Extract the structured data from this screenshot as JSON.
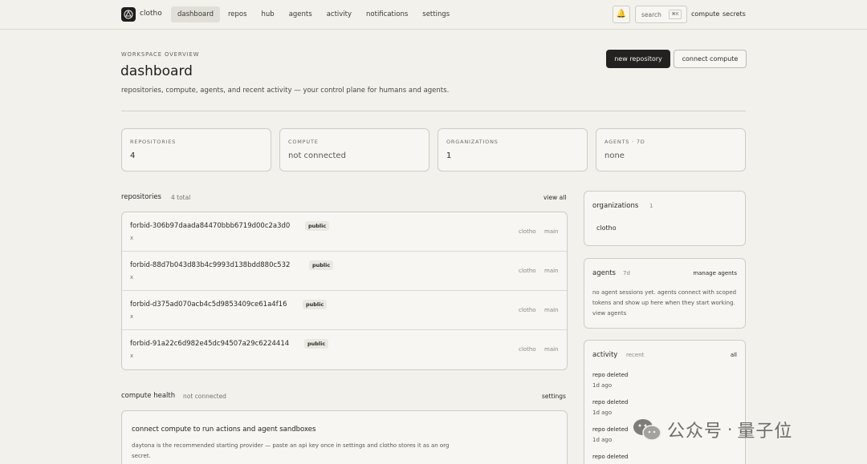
{
  "app": {
    "name": "clotho"
  },
  "nav": [
    {
      "label": "dashboard",
      "active": true
    },
    {
      "label": "repos"
    },
    {
      "label": "hub"
    },
    {
      "label": "agents"
    },
    {
      "label": "activity"
    },
    {
      "label": "notifications"
    },
    {
      "label": "settings"
    }
  ],
  "topbar": {
    "search_placeholder": "search",
    "search_shortcut": "⌘K",
    "compute_link": "compute",
    "secrets_link": "secrets"
  },
  "header": {
    "eyebrow": "WORKSPACE OVERVIEW",
    "title": "dashboard",
    "subtitle": "repositories, compute, agents, and recent activity — your control plane for humans and agents.",
    "new_repo_label": "new repository",
    "connect_compute_label": "connect compute"
  },
  "stats": [
    {
      "label": "REPOSITORIES",
      "value": "4"
    },
    {
      "label": "COMPUTE",
      "value": "not connected"
    },
    {
      "label": "ORGANIZATIONS",
      "value": "1"
    },
    {
      "label": "AGENTS · 7D",
      "value": "none"
    }
  ],
  "repositories": {
    "title": "repositories",
    "total": "4 total",
    "view_all": "view all",
    "items": [
      {
        "name": "forbid-306b97daada84470bbb6719d00c2a3d0",
        "visibility": "public",
        "description": "x",
        "owner": "clotho",
        "branch": "main"
      },
      {
        "name": "forbid-88d7b043d83b4c9993d138bdd880c532",
        "visibility": "public",
        "description": "x",
        "owner": "clotho",
        "branch": "main"
      },
      {
        "name": "forbid-d375ad070acb4c5d9853409ce61a4f16",
        "visibility": "public",
        "description": "x",
        "owner": "clotho",
        "branch": "main"
      },
      {
        "name": "forbid-91a22c6d982e45dc94507a29c6224414",
        "visibility": "public",
        "description": "x",
        "owner": "clotho",
        "branch": "main"
      }
    ]
  },
  "compute_health": {
    "title": "compute health",
    "status": "not connected",
    "settings_link": "settings",
    "card_title": "connect compute to run actions and agent sandboxes",
    "card_desc": "daytona is the recommended starting provider — paste an api key once in settings and clotho stores it as an org secret."
  },
  "organizations": {
    "title": "organizations",
    "count": "1",
    "items": [
      "clotho"
    ]
  },
  "agents": {
    "title": "agents",
    "period": "7d",
    "manage_link": "manage agents",
    "message": "no agent sessions yet. agents connect with scoped tokens and show up here when they start working. view agents"
  },
  "activity": {
    "title": "activity",
    "sub": "recent",
    "all_link": "all",
    "items": [
      {
        "title": "repo deleted",
        "time": "1d ago"
      },
      {
        "title": "repo deleted",
        "time": "1d ago"
      },
      {
        "title": "repo deleted",
        "time": "1d ago"
      },
      {
        "title": "repo deleted",
        "time": ""
      }
    ]
  },
  "watermark": {
    "text": "公众号",
    "dot": "·",
    "brand": "量子位"
  }
}
